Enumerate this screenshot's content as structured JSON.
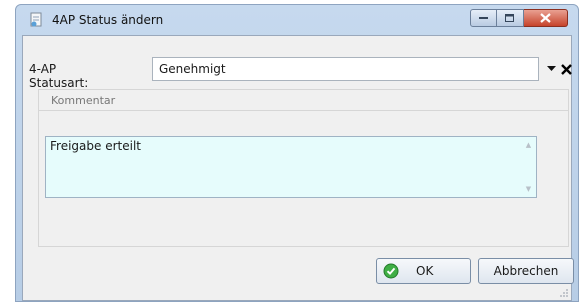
{
  "window": {
    "title": "4AP Status ändern"
  },
  "form": {
    "statusart_label": "4-AP Statusart:",
    "statusart_value": "Genehmigt",
    "comment_group_label": "Kommentar",
    "comment_value": "Freigabe erteilt"
  },
  "buttons": {
    "ok_label": "OK",
    "cancel_label": "Abbrechen"
  },
  "icons": {
    "app": "document-edit-icon",
    "dropdown": "triangle-down-icon",
    "clear": "x-clear-icon",
    "ok": "green-check-circle-icon"
  },
  "colors": {
    "comment_bg": "#e6fcfc",
    "close_button": "#c6432b",
    "ok_icon": "#2e9e3a"
  }
}
